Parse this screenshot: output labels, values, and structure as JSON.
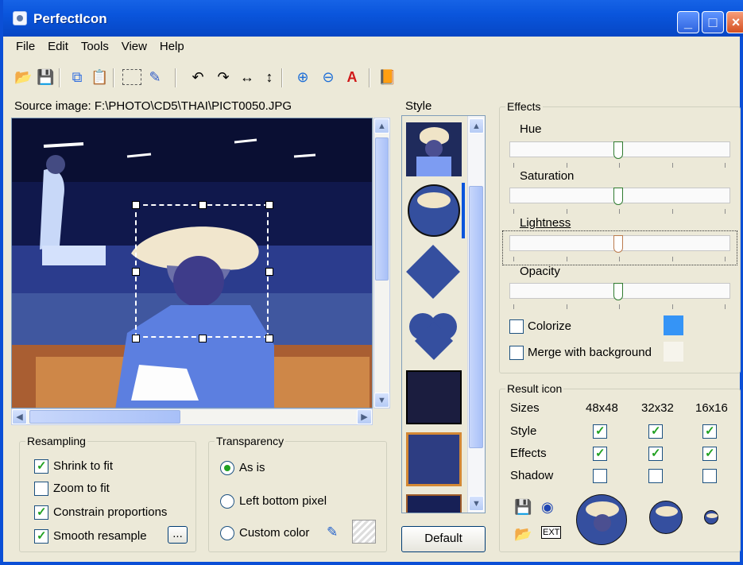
{
  "window": {
    "title": "PerfectIcon"
  },
  "menu": [
    "File",
    "Edit",
    "Tools",
    "View",
    "Help"
  ],
  "toolbar": {
    "icons": [
      "open-icon",
      "save-icon",
      "copy-icon",
      "paste-icon",
      "select-icon",
      "eyedropper-icon",
      "rotate-left-icon",
      "rotate-right-icon",
      "flip-horizontal-icon",
      "flip-vertical-icon",
      "zoom-in-icon",
      "zoom-out-icon",
      "text-tool-icon",
      "book-icon"
    ]
  },
  "source": {
    "label": "Source image: F:\\PHOTO\\CD5\\THAI\\PICT0050.JPG"
  },
  "style": {
    "label": "Style",
    "default_button": "Default"
  },
  "effects": {
    "title": "Effects",
    "hue": "Hue",
    "saturation": "Saturation",
    "lightness": "Lightness",
    "opacity": "Opacity",
    "colorize": "Colorize",
    "merge": "Merge with background",
    "hue_value": 0.5,
    "saturation_value": 0.5,
    "lightness_value": 0.5,
    "opacity_value": 0.5,
    "colorize_color": "#3594f6",
    "merge_color": "#f6f4ec"
  },
  "resampling": {
    "title": "Resampling",
    "shrink": "Shrink to fit",
    "zoom": "Zoom to fit",
    "constrain": "Constrain proportions",
    "smooth": "Smooth resample",
    "more": "..."
  },
  "transparency": {
    "title": "Transparency",
    "as_is": "As is",
    "left_bottom": "Left bottom pixel",
    "custom": "Custom color"
  },
  "result": {
    "title": "Result icon",
    "sizes_label": "Sizes",
    "style_label": "Style",
    "effects_label": "Effects",
    "shadow_label": "Shadow",
    "col48": "48x48",
    "col32": "32x32",
    "col16": "16x16"
  },
  "colors": {
    "accent": "#0a55dc",
    "frame": "#ece9d8"
  }
}
